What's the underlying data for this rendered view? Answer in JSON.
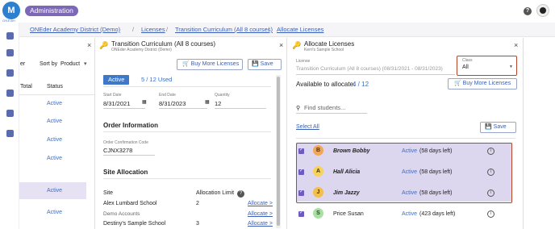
{
  "header": {
    "logo_text": "M",
    "logo_sub": "ONEder",
    "admin_label": "Administration",
    "help_icon": "?"
  },
  "breadcrumb": {
    "items": [
      "ONEder Academy District (Demo)",
      "Licenses",
      "Transition Curriculum (All 8 courses)",
      "Allocate Licenses"
    ],
    "sep": "/"
  },
  "left_panel": {
    "close": "×",
    "sort_label": "Sort by",
    "sort_value": "Product",
    "sort_chevron": "▾",
    "col_total": "Total",
    "col_status": "Status",
    "er_text": "er",
    "rows": [
      "Active",
      "Active",
      "Active",
      "Active",
      "Active",
      "Active"
    ]
  },
  "mid_panel": {
    "title": "Transition Curriculum (All 8 courses)",
    "subtitle": "ONEder Academy District (Demo)",
    "close": "×",
    "buy_label": "Buy More Licenses",
    "save_label": "Save",
    "status": "Active",
    "used": "5 / 12 Used",
    "start_label": "Start Date",
    "start_value": "8/31/2021",
    "end_label": "End Date",
    "end_value": "8/31/2023",
    "qty_label": "Quantity",
    "qty_value": "12",
    "order_section": "Order Information",
    "order_code_label": "Order Confirmation Code",
    "order_code": "CJNX3278",
    "site_section": "Site Allocation",
    "site_col": "Site",
    "limit_col": "Allocation Limit",
    "sites": [
      {
        "name": "Alex Lumbard School",
        "limit": "2",
        "link": "Allocate >"
      },
      {
        "name": "Demo Accounts",
        "limit": "",
        "link": "Allocate >"
      },
      {
        "name": "Destiny's Sample School",
        "limit": "3",
        "link": "Allocate >"
      }
    ]
  },
  "right_panel": {
    "title": "Allocate Licenses",
    "subtitle": "Kerri's Sample School",
    "close": "×",
    "license_label": "License",
    "license_value": "Transition Curriculum (All 8 courses) (08/31/2021 - 08/31/2023)",
    "class_label": "Class",
    "class_value": "All",
    "available_label": "Available to allocate:",
    "available_value": "4 / 12",
    "buy_label": "Buy More Licenses",
    "search_placeholder": "Find students...",
    "select_all": "Select All",
    "save_label": "Save",
    "students": [
      {
        "initial": "B",
        "name": "Brown Bobby",
        "status": "Active",
        "days": "(58 days left)",
        "color": "#f0a75a",
        "selected": true
      },
      {
        "initial": "A",
        "name": "Hall Alicia",
        "status": "Active",
        "days": "(58 days left)",
        "color": "#f6d35a",
        "selected": true
      },
      {
        "initial": "J",
        "name": "Jim Jazzy",
        "status": "Active",
        "days": "(58 days left)",
        "color": "#f2c04a",
        "selected": true
      },
      {
        "initial": "S",
        "name": "Price Susan",
        "status": "Active",
        "days": "(423 days left)",
        "color": "#a9dfa3",
        "selected": true
      }
    ]
  },
  "colors": {
    "accent": "#7d68b8",
    "link": "#3b5fb6",
    "highlight": "#e6e2f4",
    "annotation": "#b5452b"
  }
}
